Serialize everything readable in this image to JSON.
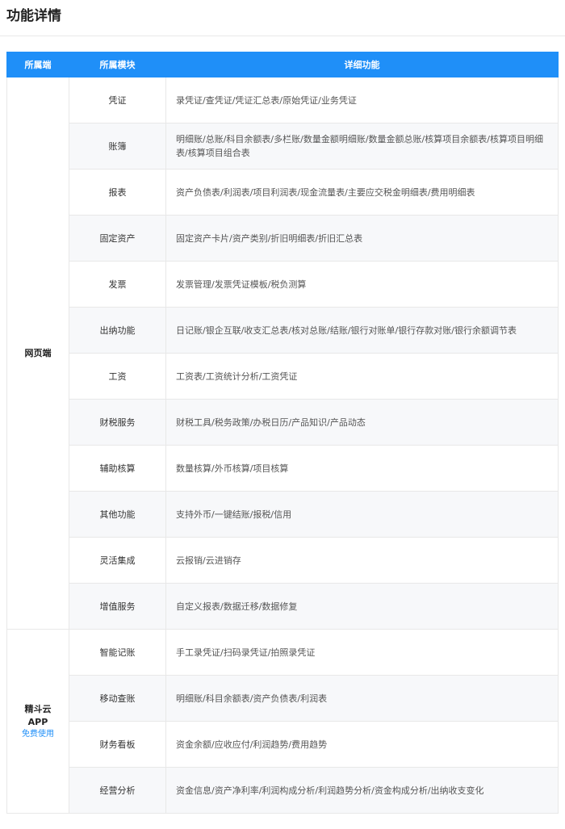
{
  "page": {
    "title": "功能详情"
  },
  "table": {
    "headers": [
      "所属端",
      "所属模块",
      "详细功能"
    ],
    "groups": [
      {
        "platform": [
          "网页端"
        ],
        "free_link": "",
        "rows": [
          {
            "module": "凭证",
            "detail": "录凭证/查凭证/凭证汇总表/原始凭证/业务凭证"
          },
          {
            "module": "账簿",
            "detail": "明细账/总账/科目余额表/多栏账/数量金额明细账/数量金额总账/核算项目余额表/核算项目明细表/核算项目组合表"
          },
          {
            "module": "报表",
            "detail": "资产负债表/利润表/项目利润表/现金流量表/主要应交税金明细表/费用明细表"
          },
          {
            "module": "固定资产",
            "detail": "固定资产卡片/资产类别/折旧明细表/折旧汇总表"
          },
          {
            "module": "发票",
            "detail": "发票管理/发票凭证模板/税负测算"
          },
          {
            "module": "出纳功能",
            "detail": "日记账/银企互联/收支汇总表/核对总账/结账/银行对账单/银行存款对账/银行余额调节表"
          },
          {
            "module": "工资",
            "detail": "工资表/工资统计分析/工资凭证"
          },
          {
            "module": "财税服务",
            "detail": "财税工具/税务政策/办税日历/产品知识/产品动态"
          },
          {
            "module": "辅助核算",
            "detail": "数量核算/外币核算/项目核算"
          },
          {
            "module": "其他功能",
            "detail": "支持外币/一键结账/报税/信用"
          },
          {
            "module": "灵活集成",
            "detail": "云报销/云进销存"
          },
          {
            "module": "增值服务",
            "detail": "自定义报表/数据迁移/数据修复"
          }
        ]
      },
      {
        "platform": [
          "精斗云",
          "APP"
        ],
        "free_link": "免费使用",
        "rows": [
          {
            "module": "智能记账",
            "detail": "手工录凭证/扫码录凭证/拍照录凭证"
          },
          {
            "module": "移动查账",
            "detail": "明细账/科目余额表/资产负债表/利润表"
          },
          {
            "module": "财务看板",
            "detail": "资金余额/应收应付/利润趋势/费用趋势"
          },
          {
            "module": "经营分析",
            "detail": "资金信息/资产净利率/利润构成分析/利润趋势分析/资金构成分析/出纳收支变化"
          }
        ]
      }
    ]
  }
}
